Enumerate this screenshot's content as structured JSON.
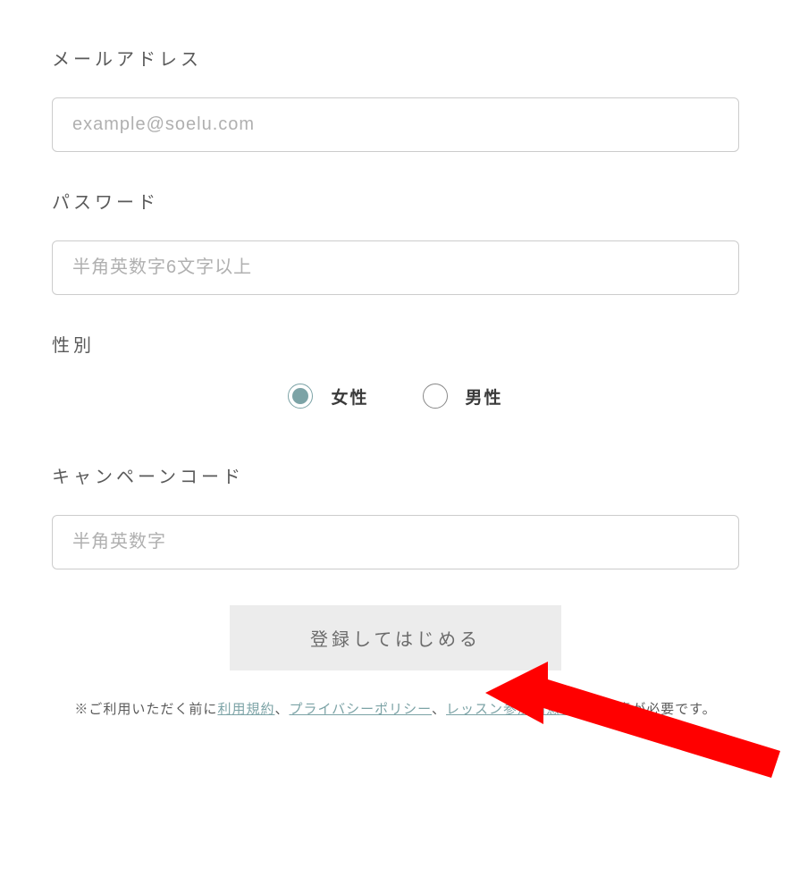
{
  "form": {
    "email": {
      "label": "メールアドレス",
      "placeholder": "example@soelu.com",
      "value": ""
    },
    "password": {
      "label": "パスワード",
      "placeholder": "半角英数字6文字以上",
      "value": ""
    },
    "gender": {
      "label": "性別",
      "options": {
        "female": "女性",
        "male": "男性"
      },
      "selected": "female"
    },
    "campaign": {
      "label": "キャンペーンコード",
      "placeholder": "半角英数字",
      "value": ""
    },
    "submit": "登録してはじめる"
  },
  "footer": {
    "prefix": "※ご利用いただく前に",
    "link1": "利用規約",
    "sep1": "、",
    "link2": "プライバシーポリシー",
    "sep2": "、",
    "link3": "レッスン参加同意書",
    "suffix": "への同意が必要です。"
  },
  "colors": {
    "accent": "#7ca3a6",
    "arrow": "#ff0000"
  }
}
